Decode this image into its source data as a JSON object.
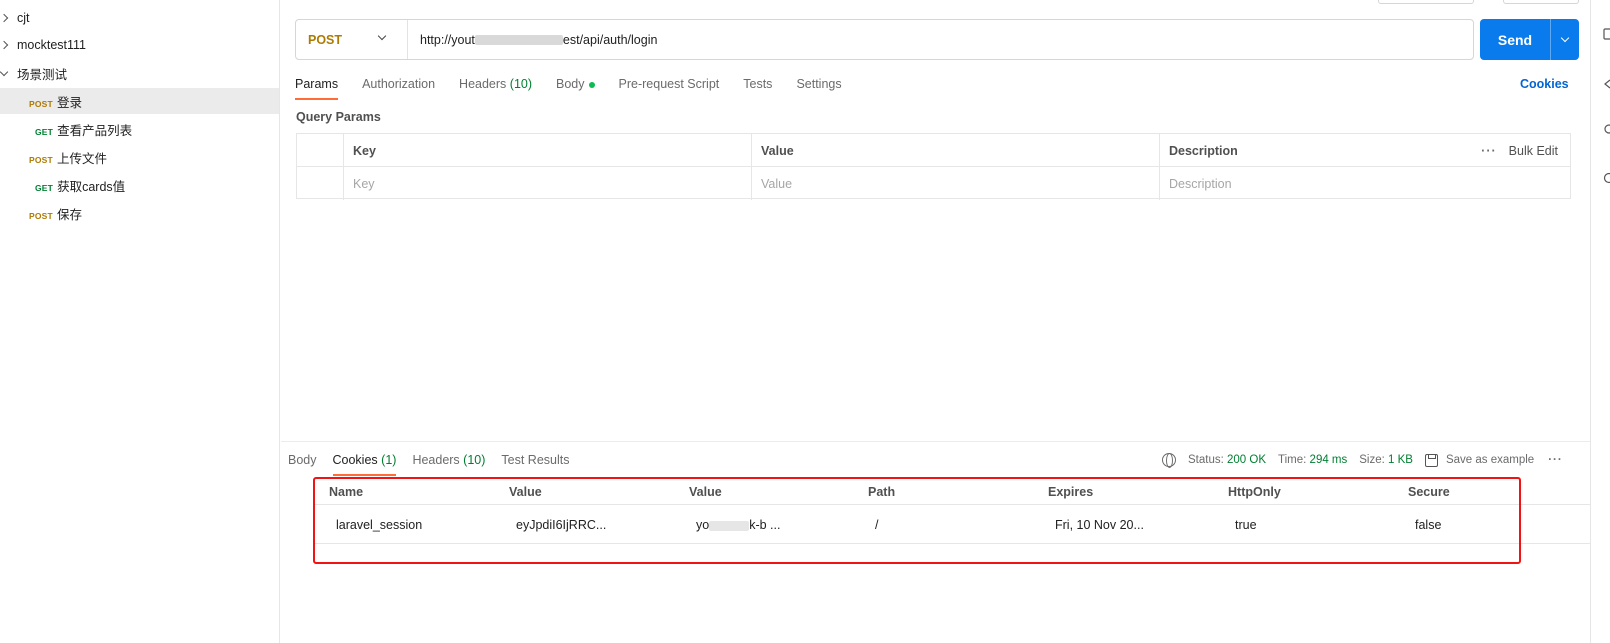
{
  "sidebar": {
    "items": [
      {
        "label": "cjt",
        "expanded": false
      },
      {
        "label": "mocktest111",
        "expanded": false
      },
      {
        "label": "场景测试",
        "expanded": true
      }
    ],
    "requests": [
      {
        "method": "POST",
        "label": "登录",
        "selected": true
      },
      {
        "method": "GET",
        "label": "查看产品列表",
        "selected": false
      },
      {
        "method": "POST",
        "label": "上传文件",
        "selected": false
      },
      {
        "method": "GET",
        "label": "获取cards值",
        "selected": false
      },
      {
        "method": "POST",
        "label": "保存",
        "selected": false
      }
    ]
  },
  "request": {
    "method": "POST",
    "url_prefix": "http://yout",
    "url_suffix": "est/api/auth/login",
    "send_label": "Send"
  },
  "tabs": {
    "params": "Params",
    "authorization": "Authorization",
    "headers": "Headers",
    "headers_count": "(10)",
    "body": "Body",
    "pre_request": "Pre-request Script",
    "tests": "Tests",
    "settings": "Settings",
    "cookies_link": "Cookies"
  },
  "params": {
    "title": "Query Params",
    "columns": [
      "Key",
      "Value",
      "Description"
    ],
    "placeholders": [
      "Key",
      "Value",
      "Description"
    ],
    "bulk_edit": "Bulk Edit"
  },
  "response": {
    "tabs": {
      "body": "Body",
      "cookies": "Cookies",
      "cookies_count": "(1)",
      "headers": "Headers",
      "headers_count": "(10)",
      "test_results": "Test Results"
    },
    "status_label": "Status:",
    "status_value": "200 OK",
    "time_label": "Time:",
    "time_value": "294 ms",
    "size_label": "Size:",
    "size_value": "1 KB",
    "save_example": "Save as example",
    "cookies_table": {
      "columns": [
        "Name",
        "Value",
        "Value",
        "Path",
        "Expires",
        "HttpOnly",
        "Secure"
      ],
      "rows": [
        {
          "name": "laravel_session",
          "value": "eyJpdiI6IjRRC...",
          "domain_prefix": "yo",
          "domain_suffix": "k-b ...",
          "path": "/",
          "expires": "Fri, 10 Nov 20...",
          "httponly": "true",
          "secure": "false"
        }
      ]
    }
  },
  "colors": {
    "post": "#ad7a03",
    "get": "#007f31",
    "send": "#097bed",
    "accent_tab": "#ff6c37",
    "status_ok": "#007f31",
    "link": "#0265d2",
    "highlight": "#f21414"
  }
}
